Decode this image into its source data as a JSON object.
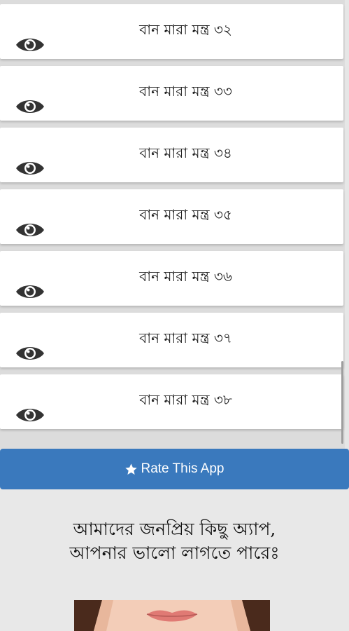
{
  "list": {
    "items": [
      {
        "label": "বান মারা মন্ত্র ৩২"
      },
      {
        "label": "বান মারা মন্ত্র ৩৩"
      },
      {
        "label": "বান মারা মন্ত্র ৩৪"
      },
      {
        "label": "বান মারা মন্ত্র ৩৫"
      },
      {
        "label": "বান মারা মন্ত্র ৩৬"
      },
      {
        "label": "বান মারা মন্ত্র ৩৭"
      },
      {
        "label": "বান মারা মন্ত্র ৩৮"
      }
    ],
    "item_icon": "eye-icon"
  },
  "rate_button": {
    "label": "Rate This App",
    "icon": "star-icon",
    "color": "#3a79bd"
  },
  "promo": {
    "heading_line1": "আমাদের জনপ্রিয় কিছু অ্যাপ,",
    "heading_line2": "আপনার ভালো লাগতে পারেঃ"
  }
}
